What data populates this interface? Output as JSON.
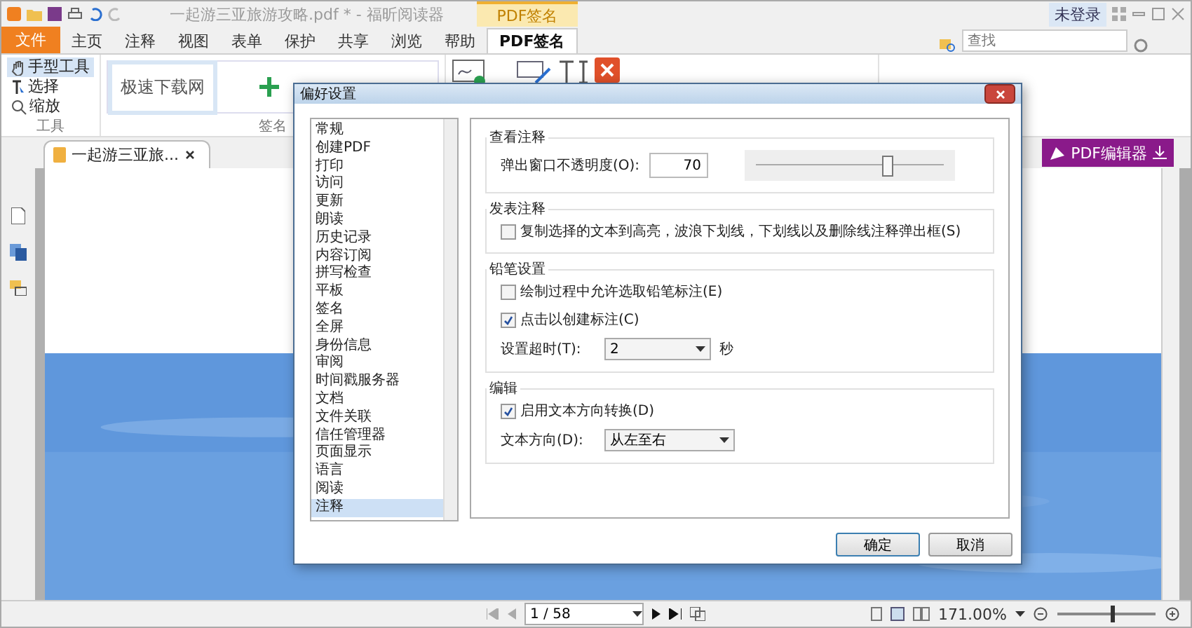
{
  "window": {
    "title": "一起游三亚旅游攻略.pdf * - 福昕阅读器",
    "context_tab": "PDF签名",
    "account": "未登录"
  },
  "tabs": [
    {
      "label": "文件",
      "kind": "file",
      "selected": false
    },
    {
      "label": "主页",
      "kind": "tab",
      "selected": false
    },
    {
      "label": "注释",
      "kind": "tab",
      "selected": false
    },
    {
      "label": "视图",
      "kind": "tab",
      "selected": false
    },
    {
      "label": "表单",
      "kind": "tab",
      "selected": false
    },
    {
      "label": "保护",
      "kind": "tab",
      "selected": false
    },
    {
      "label": "共享",
      "kind": "tab",
      "selected": false
    },
    {
      "label": "浏览",
      "kind": "tab",
      "selected": false
    },
    {
      "label": "帮助",
      "kind": "tab",
      "selected": false
    },
    {
      "label": "PDF签名",
      "kind": "tab",
      "selected": true
    }
  ],
  "search": {
    "placeholder": "查找"
  },
  "ribbon": {
    "tools": [
      {
        "label": "手型工具",
        "kind": "hand",
        "selected": true
      },
      {
        "label": "选择",
        "kind": "select",
        "selected": false
      },
      {
        "label": "缩放",
        "kind": "zoom",
        "selected": false
      }
    ],
    "tools_group": "工具",
    "signature_sample": "极速下载网",
    "signature_group": "签名"
  },
  "document_tab": {
    "title": "一起游三亚旅..."
  },
  "pdf_editor_button": "PDF编辑器",
  "dialog": {
    "title": "偏好设置",
    "categories": [
      {
        "label": "常规",
        "selected": false
      },
      {
        "label": "创建PDF",
        "selected": false
      },
      {
        "label": "打印",
        "selected": false
      },
      {
        "label": "访问",
        "selected": false
      },
      {
        "label": "更新",
        "selected": false
      },
      {
        "label": "朗读",
        "selected": false
      },
      {
        "label": "历史记录",
        "selected": false
      },
      {
        "label": "内容订阅",
        "selected": false
      },
      {
        "label": "拼写检查",
        "selected": false
      },
      {
        "label": "平板",
        "selected": false
      },
      {
        "label": "签名",
        "selected": false
      },
      {
        "label": "全屏",
        "selected": false
      },
      {
        "label": "身份信息",
        "selected": false
      },
      {
        "label": "审阅",
        "selected": false
      },
      {
        "label": "时间戳服务器",
        "selected": false
      },
      {
        "label": "文档",
        "selected": false
      },
      {
        "label": "文件关联",
        "selected": false
      },
      {
        "label": "信任管理器",
        "selected": false
      },
      {
        "label": "页面显示",
        "selected": false
      },
      {
        "label": "语言",
        "selected": false
      },
      {
        "label": "阅读",
        "selected": false
      },
      {
        "label": "注释",
        "selected": true
      }
    ],
    "sections": [
      {
        "title": "查看注释",
        "rows": [
          {
            "kind": "slider",
            "label": "弹出窗口不透明度(O):",
            "value": "70",
            "level": 0.7
          }
        ]
      },
      {
        "title": "发表注释",
        "rows": [
          {
            "kind": "checkbox",
            "label": "复制选择的文本到高亮，波浪下划线，下划线以及删除线注释弹出框(S)",
            "checked": false
          }
        ]
      },
      {
        "title": "铅笔设置",
        "rows": [
          {
            "kind": "checkbox",
            "label": "绘制过程中允许选取铅笔标注(E)",
            "checked": false
          },
          {
            "kind": "checkbox",
            "label": "点击以创建标注(C)",
            "checked": true
          },
          {
            "kind": "select",
            "label": "设置超时(T):",
            "value": "2",
            "unit": "秒"
          }
        ]
      },
      {
        "title": "编辑",
        "rows": [
          {
            "kind": "checkbox",
            "label": "启用文本方向转换(D)",
            "checked": true
          },
          {
            "kind": "select",
            "label": "文本方向(D):",
            "value": "从左至右"
          }
        ]
      }
    ],
    "buttons": [
      "确定",
      "取消"
    ]
  },
  "status_bar": {
    "page": "1 / 58",
    "zoom": "171.00%",
    "zoom_slider": {
      "level": 0.56
    }
  }
}
